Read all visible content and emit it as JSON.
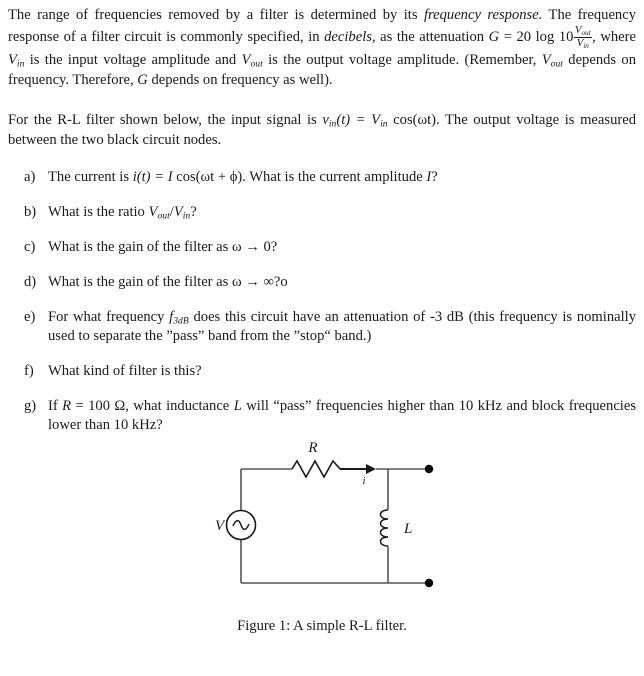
{
  "document": {
    "paragraph_1": {
      "seg_1": "The range of frequencies removed by a filter is determined by its ",
      "italic_1": "frequency response.",
      "seg_2": " The frequency response of a filter circuit is commonly specified, in ",
      "italic_2": "decibels",
      "seg_3": ", as the attenuation ",
      "formula_G": "G",
      "formula_eq": " = ",
      "formula_20log": "20 log 10",
      "frac_num": "V",
      "frac_num_sub": "out",
      "frac_den": "V",
      "frac_den_sub": "in",
      "seg_4": ", where ",
      "var_vin": "V",
      "var_vin_sub": "in",
      "seg_5": " is the input voltage amplitude and ",
      "var_vout": "V",
      "var_vout_sub": "out",
      "seg_6": " is the output voltage amplitude. (Remember, ",
      "var_vout2": "V",
      "var_vout2_sub": "out",
      "seg_7": " depends on frequency. Therefore, ",
      "var_g2": "G",
      "seg_8": " depends on frequency as well)."
    },
    "paragraph_2": {
      "seg_1": "For the R-L filter shown below, the input signal is ",
      "var_vin": "v",
      "var_vin_sub": "in",
      "seg_2": "(t) = ",
      "var_Vin": "V",
      "var_Vin_sub": "in",
      "seg_3": " cos(ωt). The output voltage is measured between the two black circuit nodes."
    },
    "questions": [
      {
        "marker": "a)",
        "seg_1": "The current is ",
        "math_1": "i",
        "seg_2": "(t) = ",
        "math_2": "I",
        "seg_3": " cos(ωt + ϕ). What is the current amplitude ",
        "math_3": "I",
        "seg_4": "?"
      },
      {
        "marker": "b)",
        "seg_1": "What is the ratio ",
        "math_1": "V",
        "math_1_sub": "out",
        "seg_2": "/",
        "math_2": "V",
        "math_2_sub": "in",
        "seg_3": "?"
      },
      {
        "marker": "c)",
        "seg_1": "What is the gain of the filter as ω → 0?"
      },
      {
        "marker": "d)",
        "seg_1": "What is the gain of the filter as ω → ∞?o"
      },
      {
        "marker": "e)",
        "seg_1": "For what frequency ",
        "math_1": "f",
        "math_1_sub": "3dB",
        "seg_2": " does this circuit have an attenuation of -3 dB (this frequency is nominally used to separate the ”pass” band from the ”stop“ band.)"
      },
      {
        "marker": "f)",
        "seg_1": "What kind of filter is this?"
      },
      {
        "marker": "g)",
        "seg_1": "If ",
        "math_1": "R",
        "seg_2": " = 100 Ω, what inductance ",
        "math_2": "L",
        "seg_3": " will “pass” frequencies higher than 10 kHz and block frequencies lower than 10 kHz?"
      }
    ],
    "figure": {
      "caption": "Figure 1: A simple R-L filter.",
      "labels": {
        "resistor": "R",
        "inductor": "L",
        "source": "V",
        "current": "i"
      },
      "colors": {
        "wire": "#555555",
        "component": "#1a1a1a",
        "node": "#000000",
        "text": "#1a1a1a"
      }
    }
  }
}
